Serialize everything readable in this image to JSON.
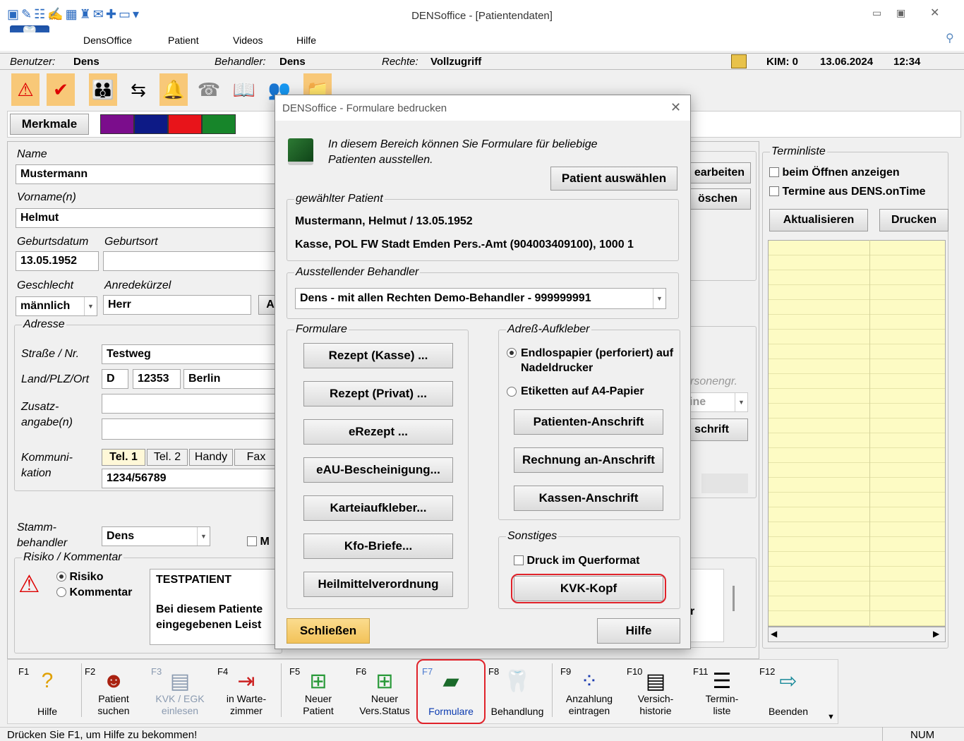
{
  "window": {
    "title": "DENSoffice - [Patientendaten]"
  },
  "menu": [
    "DensOffice",
    "Patient",
    "Videos",
    "Hilfe"
  ],
  "infobar": {
    "user_label": "Benutzer:",
    "user": "Dens",
    "treater_label": "Behandler:",
    "treater": "Dens",
    "rights_label": "Rechte:",
    "rights": "Vollzugriff",
    "kim": "KIM: 0",
    "date": "13.06.2024",
    "time": "12:34"
  },
  "merkmale": {
    "label": "Merkmale",
    "colors": [
      "#7b0d8c",
      "#0d1a86",
      "#e8141a",
      "#17852a"
    ]
  },
  "patient": {
    "name_label": "Name",
    "name": "Mustermann",
    "vorname_label": "Vorname(n)",
    "vorname": "Helmut",
    "geburtsdatum_label": "Geburtsdatum",
    "geburtsdatum": "13.05.1952",
    "geburtsort_label": "Geburtsort",
    "geburtsort": "",
    "geschlecht_label": "Geschlecht",
    "geschlecht": "männlich",
    "anrede_label": "Anredekürzel",
    "anrede": "Herr",
    "a_btn": "A"
  },
  "adresse": {
    "group": "Adresse",
    "strasse_label": "Straße / Nr.",
    "strasse": "Testweg",
    "land_label": "Land/PLZ/Ort",
    "land": "D",
    "plz": "12353",
    "ort": "Berlin",
    "zusatz_label_1": "Zusatz-",
    "zusatz_label_2": "angabe(n)",
    "komm_label_1": "Kommuni-",
    "komm_label_2": "kation",
    "tabs": [
      "Tel. 1",
      "Tel. 2",
      "Handy",
      "Fax"
    ],
    "tel": "1234/56789"
  },
  "stamm": {
    "label_1": "Stamm-",
    "label_2": "behandler",
    "value": "Dens",
    "m_label": "M"
  },
  "risiko": {
    "group": "Risiko / Kommentar",
    "radio_risiko": "Risiko",
    "radio_kommentar": "Kommentar",
    "text_1": "TESTPATIENT",
    "text_2": "Bei diesem Patiente",
    "text_3": "eingegebenen Leist"
  },
  "right_partial": {
    "bearbeiten": "earbeiten",
    "loeschen": "öschen",
    "personengr": "rsonengr.",
    "keine": "ine",
    "anschrift": "schrift",
    "r": "r"
  },
  "termin": {
    "group": "Terminliste",
    "cb_1": "beim Öffnen anzeigen",
    "cb_2": "Termine aus DENS.onTime",
    "btn_aktualisieren": "Aktualisieren",
    "btn_drucken": "Drucken"
  },
  "dialog": {
    "title": "DENSoffice - Formulare bedrucken",
    "intro": "In diesem Bereich können Sie Formulare für beliebige Patienten ausstellen.",
    "btn_patient": "Patient auswählen",
    "gew_group": "gewählter Patient",
    "gew_line1": "Mustermann, Helmut / 13.05.1952",
    "gew_line2": "Kasse, POL FW Stadt  Emden Pers.-Amt (904003409100), 1000 1",
    "behandler_group": "Ausstellender Behandler",
    "behandler": "Dens - mit allen Rechten Demo-Behandler - 999999991",
    "formulare_group": "Formulare",
    "formulare": [
      "Rezept (Kasse) ...",
      "Rezept (Privat) ...",
      "eRezept ...",
      "eAU-Bescheinigung...",
      "Karteiaufkleber...",
      "Kfo-Briefe...",
      "Heilmittelverordnung"
    ],
    "adress_group": "Adreß-Aufkleber",
    "radio_endlos": "Endlospapier (perforiert) auf Nadeldrucker",
    "radio_etiketten": "Etiketten auf A4-Papier",
    "adress_buttons": [
      "Patienten-Anschrift",
      "Rechnung an-Anschrift",
      "Kassen-Anschrift"
    ],
    "sonstiges_group": "Sonstiges",
    "cb_quer": "Druck im Querformat",
    "btn_kvk": "KVK-Kopf",
    "btn_close": "Schließen",
    "btn_help": "Hilfe",
    "highlight_color": "#e0222a"
  },
  "fkeys": [
    {
      "key": "F1",
      "label": "Hilfe",
      "icon": "question-icon"
    },
    {
      "key": "F2",
      "label": "Patient suchen",
      "icon": "person-search-icon"
    },
    {
      "key": "F3",
      "label": "KVK / EGK einlesen",
      "icon": "card-reader-icon"
    },
    {
      "key": "F4",
      "label": "in Warte-zimmer",
      "icon": "waiting-room-icon"
    },
    {
      "key": "F5",
      "label": "Neuer Patient",
      "icon": "new-patient-icon"
    },
    {
      "key": "F6",
      "label": "Neuer Vers.Status",
      "icon": "new-status-icon"
    },
    {
      "key": "F7",
      "label": "Formulare",
      "icon": "forms-book-icon"
    },
    {
      "key": "F8",
      "label": "Behandlung",
      "icon": "tooth-icon"
    },
    {
      "key": "F9",
      "label": "Anzahlung eintragen",
      "icon": "payment-icon"
    },
    {
      "key": "F10",
      "label": "Versich-historie",
      "icon": "history-icon"
    },
    {
      "key": "F11",
      "label": "Termin-liste",
      "icon": "list-icon"
    },
    {
      "key": "F12",
      "label": "Beenden",
      "icon": "exit-door-icon"
    }
  ],
  "status": {
    "text": "Drücken Sie F1, um Hilfe zu bekommen!",
    "num": "NUM"
  }
}
